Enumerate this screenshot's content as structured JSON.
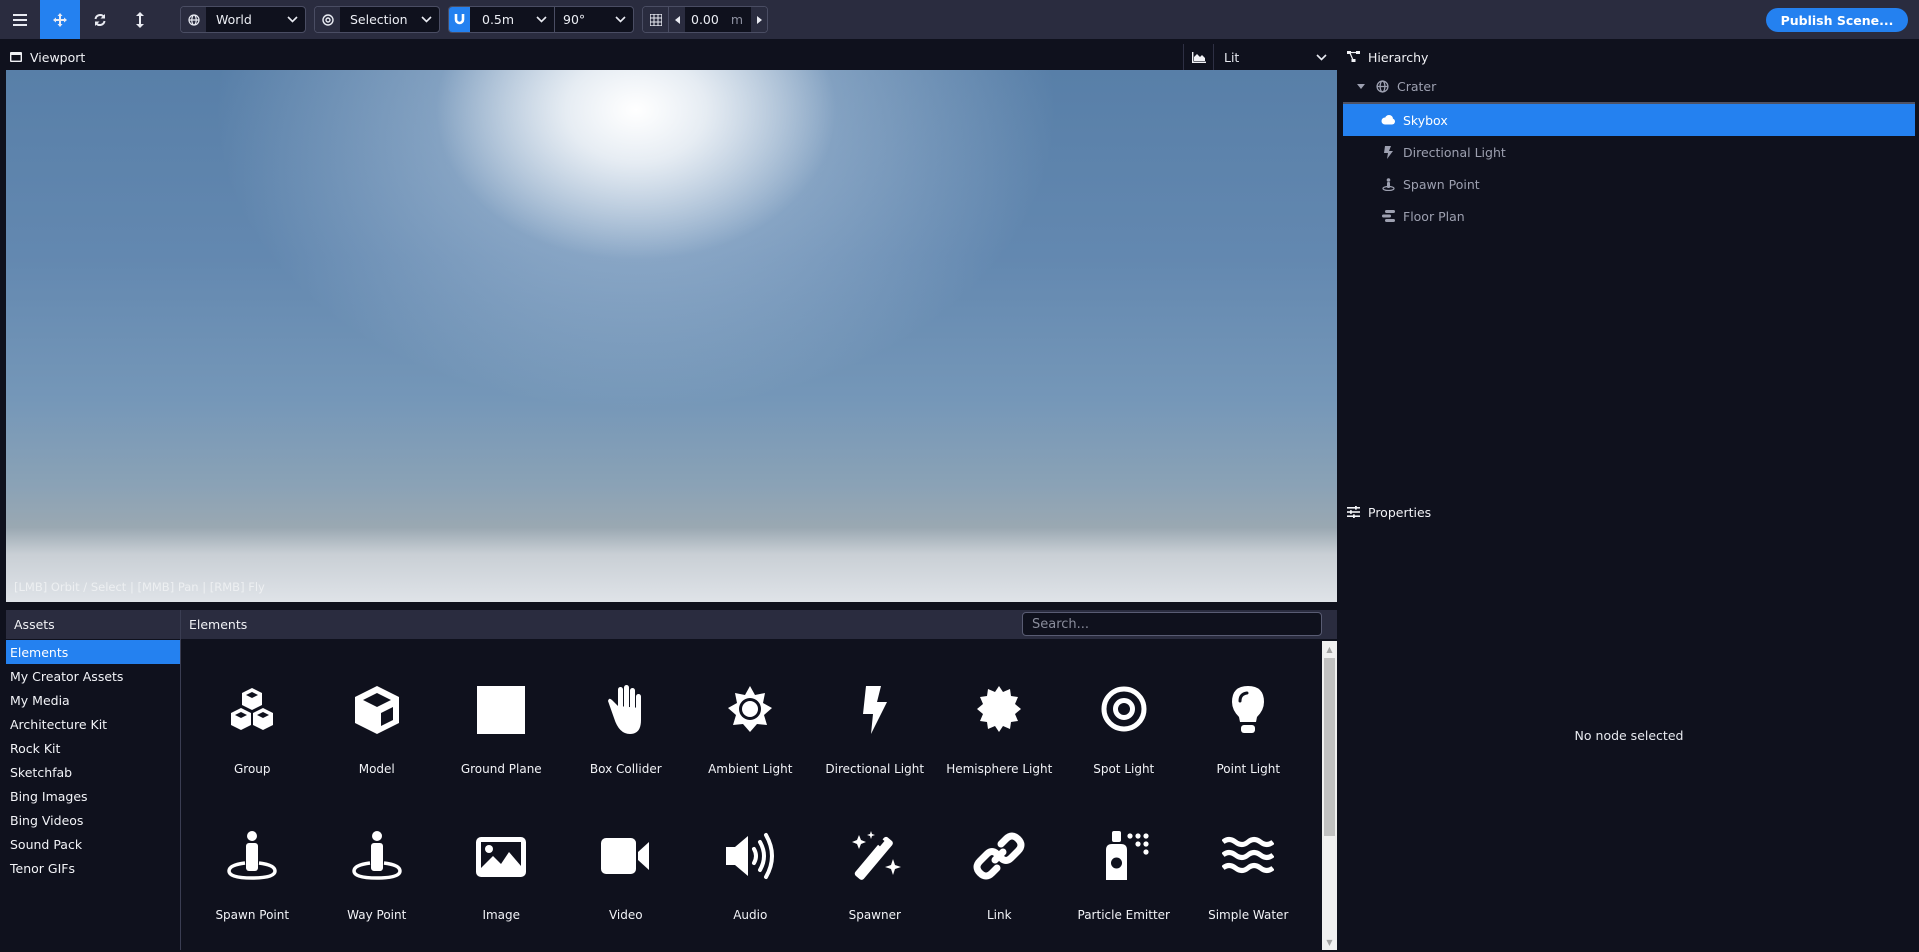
{
  "toolbar": {
    "buttons": [
      {
        "name": "menu",
        "icon": "hamburger-icon",
        "active": false
      },
      {
        "name": "move",
        "icon": "move-arrows-icon",
        "active": true
      },
      {
        "name": "rotate",
        "icon": "rotate-icon",
        "active": false
      },
      {
        "name": "scale",
        "icon": "vertical-arrows-icon",
        "active": false
      }
    ],
    "space": {
      "icon": "globe-icon",
      "value": "World"
    },
    "pivot": {
      "icon": "target-icon",
      "value": "Selection"
    },
    "snap": {
      "icon": "magnet-icon",
      "translate_value": "0.5m",
      "rotate_value": "90°"
    },
    "grid": {
      "icon": "grid-icon",
      "value": "0.00",
      "unit": "m"
    },
    "publish_label": "Publish Scene..."
  },
  "viewport": {
    "title": "Viewport",
    "render_mode": "Lit",
    "hint": "[LMB] Orbit / Select | [MMB] Pan | [RMB] Fly"
  },
  "hierarchy": {
    "title": "Hierarchy",
    "root": {
      "label": "Crater",
      "icon": "globe-icon",
      "expanded": true
    },
    "children": [
      {
        "label": "Skybox",
        "icon": "cloud-icon",
        "selected": true
      },
      {
        "label": "Directional Light",
        "icon": "bolt-icon",
        "selected": false
      },
      {
        "label": "Spawn Point",
        "icon": "person-ring-icon",
        "selected": false
      },
      {
        "label": "Floor Plan",
        "icon": "floor-plan-icon",
        "selected": false
      }
    ]
  },
  "properties": {
    "title": "Properties",
    "empty_message": "No node selected"
  },
  "assets": {
    "title": "Assets",
    "items": [
      {
        "label": "Elements",
        "selected": true
      },
      {
        "label": "My Creator Assets"
      },
      {
        "label": "My Media"
      },
      {
        "label": "Architecture Kit"
      },
      {
        "label": "Rock Kit"
      },
      {
        "label": "Sketchfab"
      },
      {
        "label": "Bing Images"
      },
      {
        "label": "Bing Videos"
      },
      {
        "label": "Sound Pack"
      },
      {
        "label": "Tenor GIFs"
      }
    ]
  },
  "elements": {
    "title": "Elements",
    "search_placeholder": "Search...",
    "items": [
      {
        "label": "Group",
        "icon": "cubes-icon"
      },
      {
        "label": "Model",
        "icon": "cube-icon"
      },
      {
        "label": "Ground Plane",
        "icon": "square-icon"
      },
      {
        "label": "Box Collider",
        "icon": "hand-icon"
      },
      {
        "label": "Ambient Light",
        "icon": "sun-icon"
      },
      {
        "label": "Directional Light",
        "icon": "bolt-icon"
      },
      {
        "label": "Hemisphere Light",
        "icon": "certificate-icon"
      },
      {
        "label": "Spot Light",
        "icon": "bullseye-icon"
      },
      {
        "label": "Point Light",
        "icon": "lightbulb-icon"
      },
      {
        "label": "Spawn Point",
        "icon": "person-ring-icon"
      },
      {
        "label": "Way Point",
        "icon": "person-ring-icon"
      },
      {
        "label": "Image",
        "icon": "image-icon"
      },
      {
        "label": "Video",
        "icon": "video-icon"
      },
      {
        "label": "Audio",
        "icon": "volume-icon"
      },
      {
        "label": "Spawner",
        "icon": "magic-wand-icon"
      },
      {
        "label": "Link",
        "icon": "link-icon"
      },
      {
        "label": "Particle Emitter",
        "icon": "spray-can-icon"
      },
      {
        "label": "Simple Water",
        "icon": "water-icon"
      }
    ]
  },
  "colors": {
    "accent": "#2481f0",
    "toolbar_bg": "#2a2c3f",
    "panel_bg": "#0f111d"
  }
}
